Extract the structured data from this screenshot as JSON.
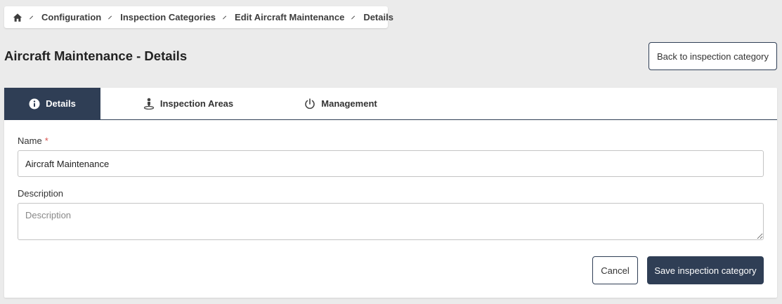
{
  "breadcrumb": {
    "home_icon": "home-icon",
    "items": [
      "Configuration",
      "Inspection Categories",
      "Edit Aircraft Maintenance",
      "Details"
    ]
  },
  "page": {
    "title": "Aircraft Maintenance - Details",
    "back_label": "Back to inspection category"
  },
  "tabs": [
    {
      "label": "Details",
      "icon": "info-icon",
      "active": true
    },
    {
      "label": "Inspection Areas",
      "icon": "location-person-icon",
      "active": false
    },
    {
      "label": "Management",
      "icon": "power-icon",
      "active": false
    }
  ],
  "form": {
    "name_label": "Name",
    "required_mark": "*",
    "name_value": "Aircraft Maintenance",
    "description_label": "Description",
    "description_placeholder": "Description",
    "description_value": ""
  },
  "actions": {
    "cancel_label": "Cancel",
    "save_label": "Save inspection category"
  },
  "colors": {
    "primary": "#2f3e55",
    "background": "#ebebeb",
    "required": "#d9534f"
  }
}
